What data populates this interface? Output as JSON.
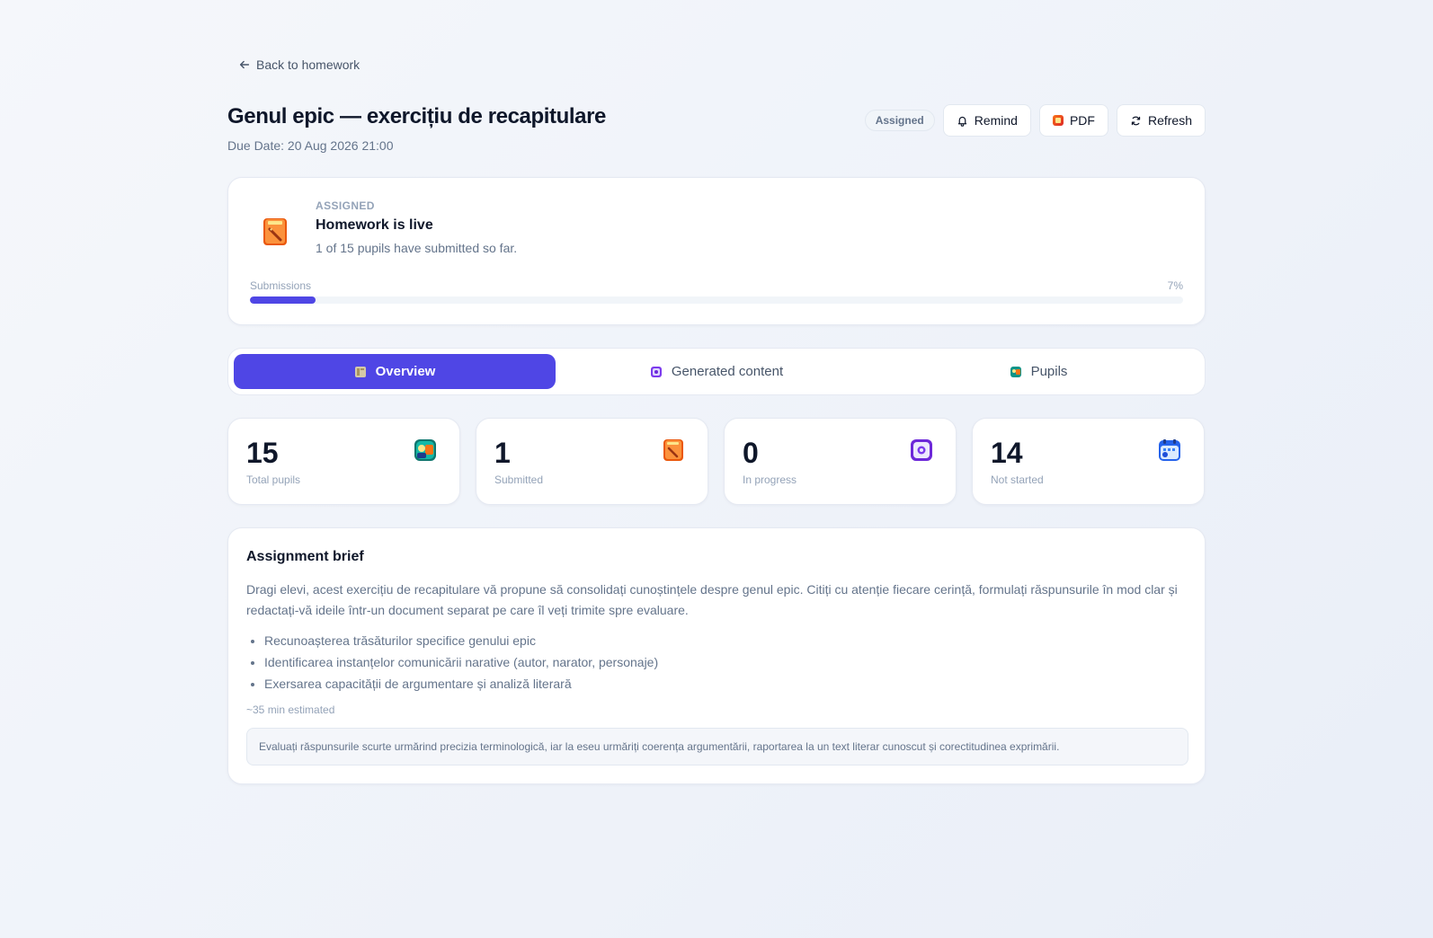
{
  "nav": {
    "back_label": "Back to homework"
  },
  "header": {
    "title": "Genul epic — exercițiu de recapitulare",
    "due": "Due Date: 20 Aug 2026 21:00",
    "status_badge": "Assigned",
    "remind_label": "Remind",
    "pdf_label": "PDF",
    "refresh_label": "Refresh"
  },
  "status": {
    "label": "ASSIGNED",
    "headline": "Homework is live",
    "subtext": "1 of 15 pupils have submitted so far.",
    "progress_label": "Submissions",
    "progress_percent_text": "7%",
    "progress_fraction": 0.07
  },
  "tabs": [
    {
      "label": "Overview",
      "icon": "book-icon",
      "active": true
    },
    {
      "label": "Generated content",
      "icon": "sparkle-box-icon",
      "active": false
    },
    {
      "label": "Pupils",
      "icon": "pupils-icon",
      "active": false
    }
  ],
  "stats": [
    {
      "value": "15",
      "label": "Total pupils",
      "icon": "pupils-icon"
    },
    {
      "value": "1",
      "label": "Submitted",
      "icon": "homework-doc-icon"
    },
    {
      "value": "0",
      "label": "In progress",
      "icon": "in-progress-icon"
    },
    {
      "value": "14",
      "label": "Not started",
      "icon": "calendar-icon"
    }
  ],
  "brief": {
    "title": "Assignment brief",
    "description": "Dragi elevi, acest exercițiu de recapitulare vă propune să consolidați cunoștințele despre genul epic. Citiți cu atenție fiecare cerință, formulați răspunsurile în mod clar și redactați-vă ideile într-un document separat pe care îl veți trimite spre evaluare.",
    "objectives": [
      "Recunoașterea trăsăturilor specifice genului epic",
      "Identificarea instanțelor comunicării narative (autor, narator, personaje)",
      "Exersarea capacității de argumentare și analiză literară"
    ],
    "estimate": "~35 min estimated",
    "teacher_note": "Evaluați răspunsurile scurte urmărind precizia terminologică, iar la eseu urmăriți coerența argumentării, raportarea la un text literar cunoscut și corectitudinea exprimării."
  },
  "colors": {
    "accent": "#4f46e5",
    "muted": "#64748b"
  }
}
